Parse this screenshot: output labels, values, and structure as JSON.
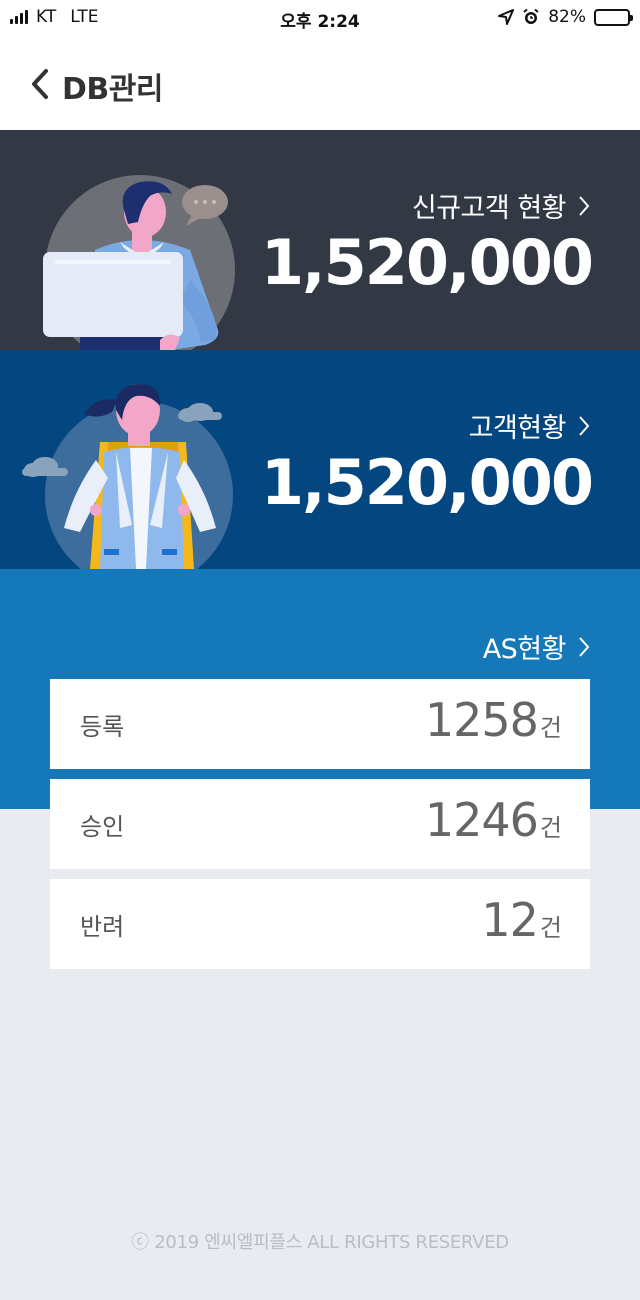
{
  "status_bar": {
    "carrier": "KT",
    "network": "LTE",
    "time": "오후 2:24",
    "battery": "82%",
    "battery_level": 0.82
  },
  "header": {
    "title": "DB관리"
  },
  "new_customers": {
    "label": "신규고객 현황",
    "value": "1,520,000"
  },
  "customers": {
    "label": "고객현황",
    "value": "1,520,000"
  },
  "as": {
    "label": "AS현황",
    "unit": "건",
    "rows": [
      {
        "name": "등록",
        "count": "1258"
      },
      {
        "name": "승인",
        "count": "1246"
      },
      {
        "name": "반려",
        "count": "12"
      }
    ]
  },
  "footer": {
    "copyright": "ⓒ 2019 엔씨엘피플스 ALL  RIGHTS  RESERVED"
  },
  "colors": {
    "dark_card": "#333845",
    "navy_card": "#04467f",
    "blue_section": "#1478b9",
    "page_bg": "#e8ebf0"
  }
}
